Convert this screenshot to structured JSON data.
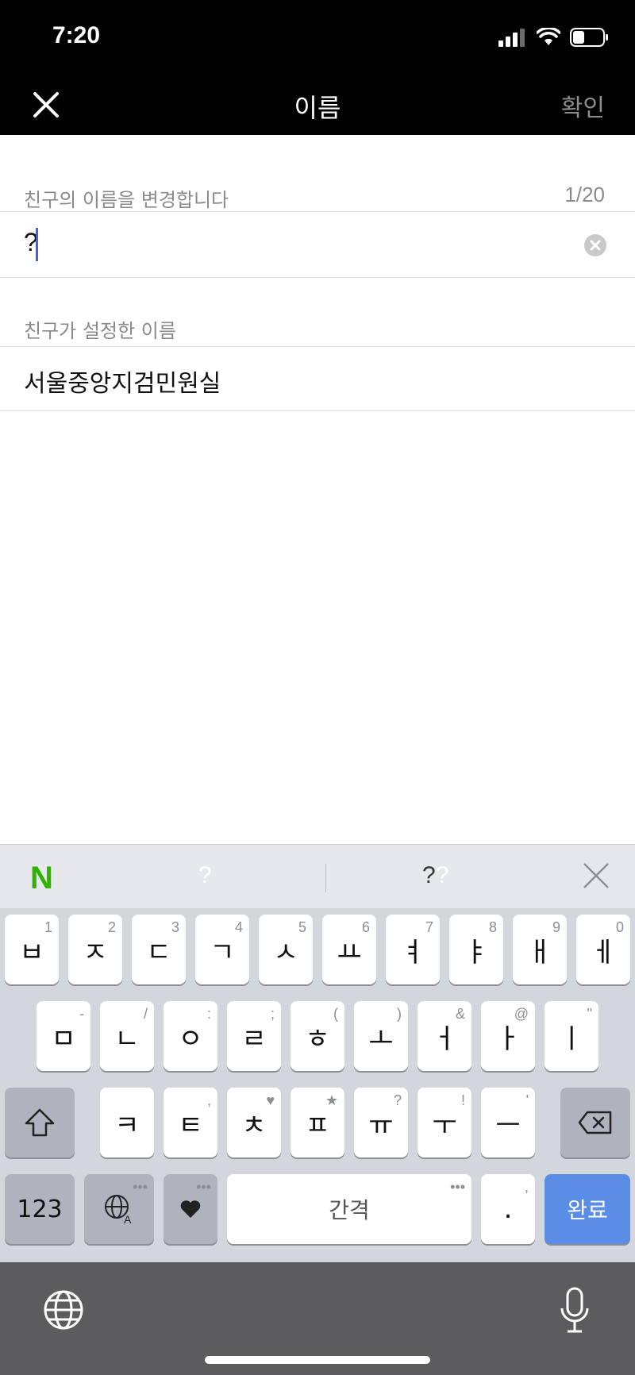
{
  "status": {
    "time": "7:20"
  },
  "nav": {
    "title": "이름",
    "confirm_label": "확인"
  },
  "name_section": {
    "label": "친구의 이름을 변경합니다",
    "counter": "1/20",
    "input_value": "?"
  },
  "friend_section": {
    "label": "친구가 설정한 이름",
    "value": "서울중앙지검민원실"
  },
  "keyboard": {
    "suggestions": {
      "first": "?",
      "second_a": "?",
      "second_b": "?"
    },
    "row1": [
      {
        "k": "ㅂ",
        "h": "1"
      },
      {
        "k": "ㅈ",
        "h": "2"
      },
      {
        "k": "ㄷ",
        "h": "3"
      },
      {
        "k": "ㄱ",
        "h": "4"
      },
      {
        "k": "ㅅ",
        "h": "5"
      },
      {
        "k": "ㅛ",
        "h": "6"
      },
      {
        "k": "ㅕ",
        "h": "7"
      },
      {
        "k": "ㅑ",
        "h": "8"
      },
      {
        "k": "ㅐ",
        "h": "9"
      },
      {
        "k": "ㅔ",
        "h": "0"
      }
    ],
    "row2": [
      {
        "k": "ㅁ",
        "h": "-"
      },
      {
        "k": "ㄴ",
        "h": "/"
      },
      {
        "k": "ㅇ",
        "h": ":"
      },
      {
        "k": "ㄹ",
        "h": ";"
      },
      {
        "k": "ㅎ",
        "h": "("
      },
      {
        "k": "ㅗ",
        "h": ")"
      },
      {
        "k": "ㅓ",
        "h": "&"
      },
      {
        "k": "ㅏ",
        "h": "@"
      },
      {
        "k": "ㅣ",
        "h": "\""
      }
    ],
    "row3": [
      {
        "k": "ㅋ",
        "h": ""
      },
      {
        "k": "ㅌ",
        "h": ","
      },
      {
        "k": "ㅊ",
        "h": "♥"
      },
      {
        "k": "ㅍ",
        "h": "★"
      },
      {
        "k": "ㅠ",
        "h": "?"
      },
      {
        "k": "ㅜ",
        "h": "!"
      },
      {
        "k": "ㅡ",
        "h": "'"
      }
    ],
    "numbers_label": "123",
    "space_label": "간격",
    "period_label": ".",
    "done_label": "완료"
  },
  "colors": {
    "accent": "#3b63e6",
    "done_key": "#5a8ee6",
    "naver_green": "#2db400"
  }
}
